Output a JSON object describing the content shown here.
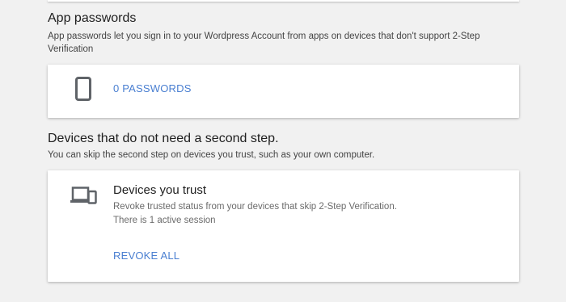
{
  "app_passwords": {
    "title": "App passwords",
    "description": "App passwords let you sign in to your Wordpress Account from apps on devices that don't support 2-Step Verification",
    "link_label": "0 PASSWORDS",
    "icon": "smartphone-icon"
  },
  "second_step": {
    "title": "Devices that do not need a second step.",
    "description": "You can skip the second step on devices you trust, such as your own computer."
  },
  "trusted_devices": {
    "title": "Devices you trust",
    "description_line1": "Revoke trusted status from your devices that skip 2-Step Verification.",
    "description_line2": "There is 1 active session",
    "action_label": "REVOKE ALL",
    "icon": "devices-icon"
  },
  "colors": {
    "link": "#4a7fd1",
    "icon": "#5f6368",
    "background": "#f1f1f1"
  }
}
